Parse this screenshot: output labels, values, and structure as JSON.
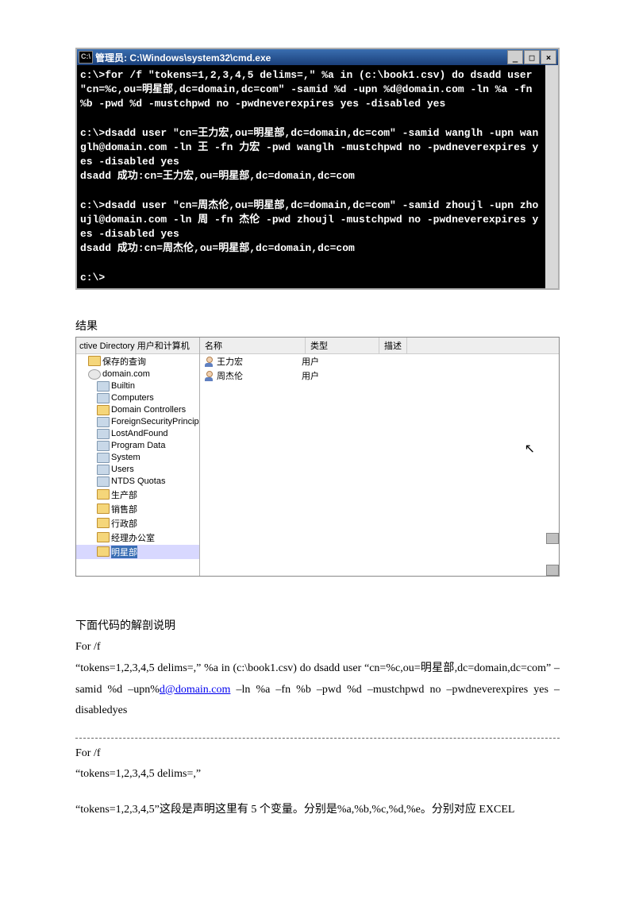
{
  "cmd": {
    "title": "管理员: C:\\Windows\\system32\\cmd.exe",
    "content": "c:\\>for /f \"tokens=1,2,3,4,5 delims=,\" %a in (c:\\book1.csv) do dsadd user \"cn=%c,ou=明星部,dc=domain,dc=com\" -samid %d -upn %d@domain.com -ln %a -fn %b -pwd %d -mustchpwd no -pwdneverexpires yes -disabled yes\n\nc:\\>dsadd user \"cn=王力宏,ou=明星部,dc=domain,dc=com\" -samid wanglh -upn wanglh@domain.com -ln 王 -fn 力宏 -pwd wanglh -mustchpwd no -pwdneverexpires yes -disabled yes\ndsadd 成功:cn=王力宏,ou=明星部,dc=domain,dc=com\n\nc:\\>dsadd user \"cn=周杰伦,ou=明星部,dc=domain,dc=com\" -samid zhoujl -upn zhoujl@domain.com -ln 周 -fn 杰伦 -pwd zhoujl -mustchpwd no -pwdneverexpires yes -disabled yes\ndsadd 成功:cn=周杰伦,ou=明星部,dc=domain,dc=com\n\nc:\\>"
  },
  "result_label": "结果",
  "ad": {
    "left_title": "ctive Directory 用户和计算机",
    "tree": [
      {
        "label": "保存的查询",
        "class": "indent1",
        "icon": "folder-icon"
      },
      {
        "label": "domain.com",
        "class": "indent1",
        "icon": "folder-icon domain"
      },
      {
        "label": "Builtin",
        "class": "indent2",
        "icon": "folder-icon blue"
      },
      {
        "label": "Computers",
        "class": "indent2",
        "icon": "folder-icon blue"
      },
      {
        "label": "Domain Controllers",
        "class": "indent2",
        "icon": "folder-icon"
      },
      {
        "label": "ForeignSecurityPrincip",
        "class": "indent2",
        "icon": "folder-icon blue"
      },
      {
        "label": "LostAndFound",
        "class": "indent2",
        "icon": "folder-icon blue"
      },
      {
        "label": "Program Data",
        "class": "indent2",
        "icon": "folder-icon blue"
      },
      {
        "label": "System",
        "class": "indent2",
        "icon": "folder-icon blue"
      },
      {
        "label": "Users",
        "class": "indent2",
        "icon": "folder-icon blue"
      },
      {
        "label": "NTDS Quotas",
        "class": "indent2",
        "icon": "folder-icon blue"
      },
      {
        "label": "生产部",
        "class": "indent2",
        "icon": "folder-icon"
      },
      {
        "label": "销售部",
        "class": "indent2",
        "icon": "folder-icon"
      },
      {
        "label": "行政部",
        "class": "indent2",
        "icon": "folder-icon"
      },
      {
        "label": "经理办公室",
        "class": "indent2",
        "icon": "folder-icon"
      },
      {
        "label": "明星部",
        "class": "indent2 selected",
        "icon": "folder-icon"
      }
    ],
    "headers": {
      "c1": "名称",
      "c2": "类型",
      "c3": "描述"
    },
    "rows": [
      {
        "name": "王力宏",
        "type": "用户"
      },
      {
        "name": "周杰伦",
        "type": "用户"
      }
    ]
  },
  "explain": {
    "heading": "下面代码的解剖说明",
    "l1": "For /f",
    "l2a": "“tokens=1,2,3,4,5 delims=,” %a in (c:\\book1.csv) do dsadd user “cn=%c,ou=明星部,dc=domain,dc=com” –samid %d –upn%",
    "link": "d@domain.com",
    "l2b": "–ln %a –fn %b –pwd %d –mustchpwd no –pwdneverexpires yes –disabledyes",
    "l3": "For /f",
    "l4": "“tokens=1,2,3,4,5 delims=,”",
    "l5": "“tokens=1,2,3,4,5”这段是声明这里有 5 个变量。分别是%a,%b,%c,%d,%e。分别对应 EXCEL"
  }
}
